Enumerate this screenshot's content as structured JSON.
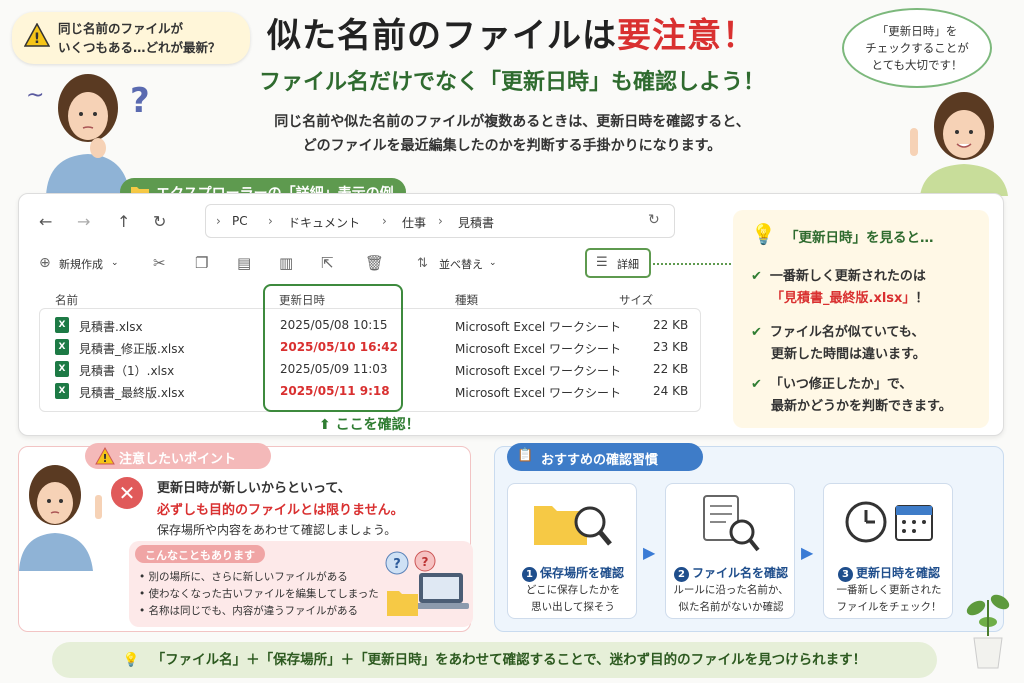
{
  "top_left_bubble": {
    "line1": "同じ名前のファイルが",
    "line2": "いくつもある…どれが最新？"
  },
  "top_right_bubble": {
    "line1": "「更新日時」を",
    "line2": "チェックすることが",
    "line3": "とても大切です！"
  },
  "title": {
    "part1": "似た名前のファイルは",
    "part2": "要注意！"
  },
  "subtitle": "ファイル名だけでなく「更新日時」も確認しよう！",
  "intro": {
    "line1": "同じ名前や似た名前のファイルが複数あるときは、更新日時を確認すると、",
    "line2": "どのファイルを最近編集したのかを判断する手掛かりになります。"
  },
  "example_label": "エクスプローラーの「詳細」表示の例",
  "explorer": {
    "breadcrumb": [
      "PC",
      "ドキュメント",
      "仕事",
      "見積書"
    ],
    "toolbar": {
      "new_label": "新規作成",
      "sort_label": "並べ替え",
      "details_label": "詳細"
    },
    "columns": {
      "name": "名前",
      "modified": "更新日時",
      "type": "種類",
      "size": "サイズ"
    },
    "rows": [
      {
        "name": "見積書.xlsx",
        "modified": "2025/05/08  10:15",
        "type": "Microsoft Excel ワークシート",
        "size": "22 KB",
        "highlight": false
      },
      {
        "name": "見積書_修正版.xlsx",
        "modified": "2025/05/10  16:42",
        "type": "Microsoft Excel ワークシート",
        "size": "23 KB",
        "highlight": true
      },
      {
        "name": "見積書（1）.xlsx",
        "modified": "2025/05/09  11:03",
        "type": "Microsoft Excel ワークシート",
        "size": "22 KB",
        "highlight": false
      },
      {
        "name": "見積書_最終版.xlsx",
        "modified": "2025/05/11  9:18",
        "type": "Microsoft Excel ワークシート",
        "size": "24 KB",
        "highlight": true
      }
    ],
    "check_here": "ここを確認！"
  },
  "info_panel": {
    "title": "「更新日時」を見ると…",
    "point1_line1": "一番新しく更新されたのは",
    "point1_file": "「見積書_最終版.xlsx」",
    "point1_tail": "！",
    "point2_line1": "ファイル名が似ていても、",
    "point2_line2": "更新した時間は違います。",
    "point3_line1": "「いつ修正したか」で、",
    "point3_line2": "最新かどうかを判断できます。"
  },
  "caution": {
    "label": "注意したいポイント",
    "line1": "更新日時が新しいからといって、",
    "line2": "必ずしも目的のファイルとは限りません。",
    "line3": "保存場所や内容をあわせて確認しましょう。",
    "sub_label": "こんなこともあります",
    "bullets": [
      "別の場所に、さらに新しいファイルがある",
      "使わなくなった古いファイルを編集してしまった",
      "名称は同じでも、内容が違うファイルがある"
    ]
  },
  "habits": {
    "label": "おすすめの確認習慣",
    "steps": [
      {
        "num": "1",
        "title": "保存場所を確認",
        "line1": "どこに保存したかを",
        "line2": "思い出して探そう"
      },
      {
        "num": "2",
        "title": "ファイル名を確認",
        "line1": "ルールに沿った名前か、",
        "line2": "似た名前がないか確認"
      },
      {
        "num": "3",
        "title": "更新日時を確認",
        "line1": "一番新しく更新された",
        "line2": "ファイルをチェック！"
      }
    ]
  },
  "footer": "「ファイル名」＋「保存場所」＋「更新日時」をあわせて確認することで、迷わず目的のファイルを見つけられます！",
  "colors": {
    "accent_red": "#d93030",
    "accent_green": "#2f6b2f",
    "accent_blue": "#1f4e8c",
    "excel_green": "#1d7a45"
  }
}
